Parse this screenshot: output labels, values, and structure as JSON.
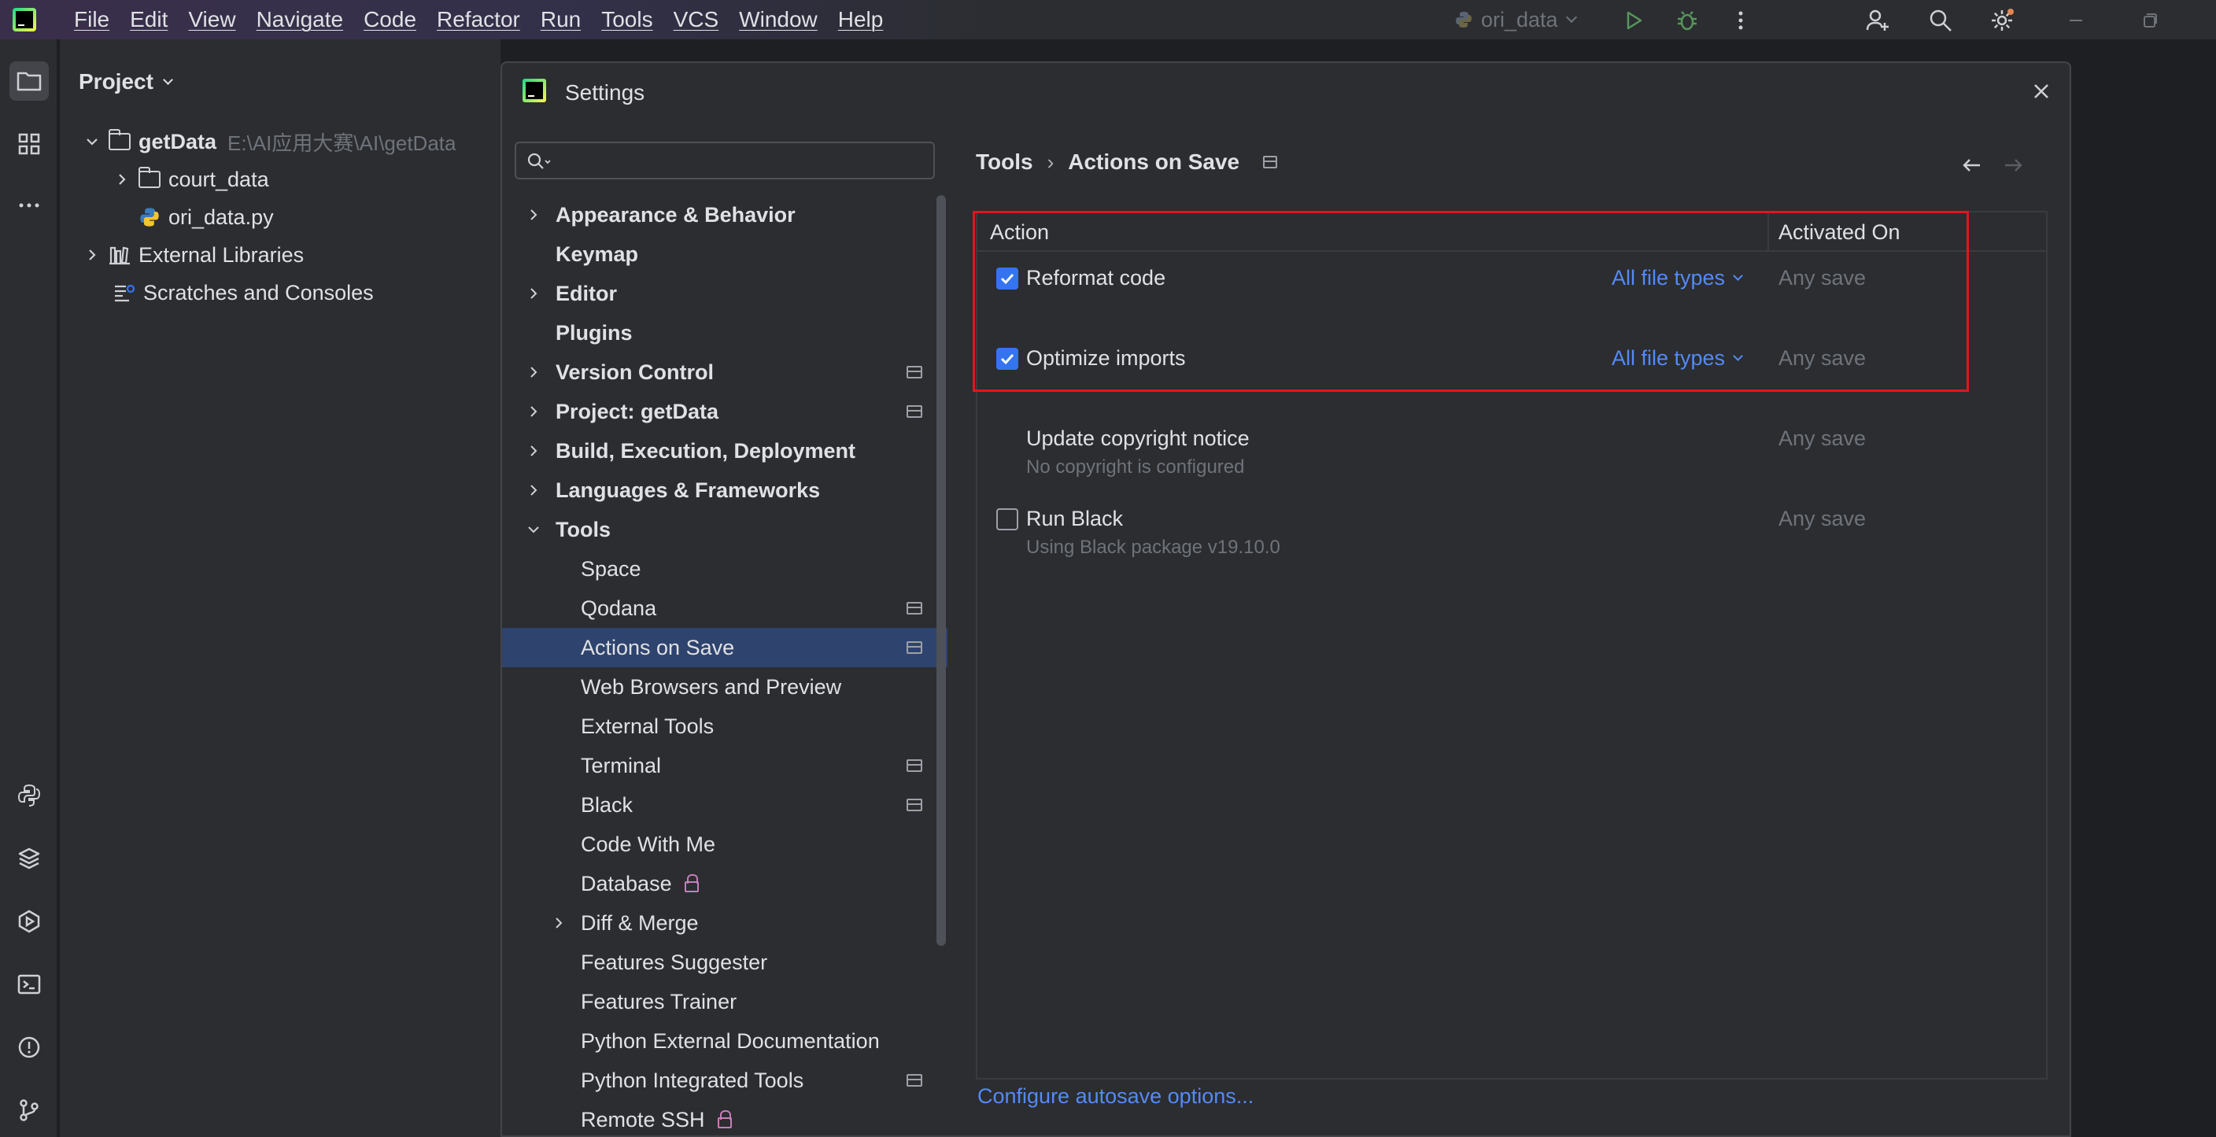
{
  "menu": [
    "File",
    "Edit",
    "View",
    "Navigate",
    "Code",
    "Refactor",
    "Run",
    "Tools",
    "VCS",
    "Window",
    "Help"
  ],
  "run_config": {
    "name": "ori_data"
  },
  "project": {
    "header": "Project",
    "tree": [
      {
        "label": "getData",
        "hint": "E:\\AI应用大赛\\AI\\getData"
      },
      {
        "label": "court_data"
      },
      {
        "label": "ori_data.py"
      },
      {
        "label": "External Libraries"
      },
      {
        "label": "Scratches and Consoles"
      }
    ]
  },
  "dialog": {
    "title": "Settings",
    "search": {
      "placeholder": "",
      "value": ""
    },
    "nav": [
      {
        "label": "Appearance & Behavior"
      },
      {
        "label": "Keymap"
      },
      {
        "label": "Editor"
      },
      {
        "label": "Plugins"
      },
      {
        "label": "Version Control"
      },
      {
        "label": "Project: getData"
      },
      {
        "label": "Build, Execution, Deployment"
      },
      {
        "label": "Languages & Frameworks"
      },
      {
        "label": "Tools"
      },
      {
        "label": "Space"
      },
      {
        "label": "Qodana"
      },
      {
        "label": "Actions on Save"
      },
      {
        "label": "Web Browsers and Preview"
      },
      {
        "label": "External Tools"
      },
      {
        "label": "Terminal"
      },
      {
        "label": "Black"
      },
      {
        "label": "Code With Me"
      },
      {
        "label": "Database"
      },
      {
        "label": "Diff & Merge"
      },
      {
        "label": "Features Suggester"
      },
      {
        "label": "Features Trainer"
      },
      {
        "label": "Python External Documentation"
      },
      {
        "label": "Python Integrated Tools"
      },
      {
        "label": "Remote SSH"
      }
    ],
    "breadcrumb": {
      "parent": "Tools",
      "separator": "›",
      "current": "Actions on Save"
    },
    "table": {
      "col_action": "Action",
      "col_activated": "Activated On",
      "rows": [
        {
          "name": "Reformat code",
          "sub": "",
          "file_types": "All file types",
          "activated": "Any save",
          "checked": true
        },
        {
          "name": "Optimize imports",
          "sub": "",
          "file_types": "All file types",
          "activated": "Any save",
          "checked": true
        },
        {
          "name": "Update copyright notice",
          "sub": "No copyright is configured",
          "file_types": "",
          "activated": "Any save",
          "checked": null
        },
        {
          "name": "Run Black",
          "sub": "Using Black package v19.10.0",
          "file_types": "",
          "activated": "Any save",
          "checked": false
        }
      ]
    },
    "autosave_link": "Configure autosave options..."
  },
  "colors": {
    "accent": "#3574f0",
    "link": "#548af7",
    "selection": "#2e436e",
    "highlight_box": "#e0161e"
  }
}
